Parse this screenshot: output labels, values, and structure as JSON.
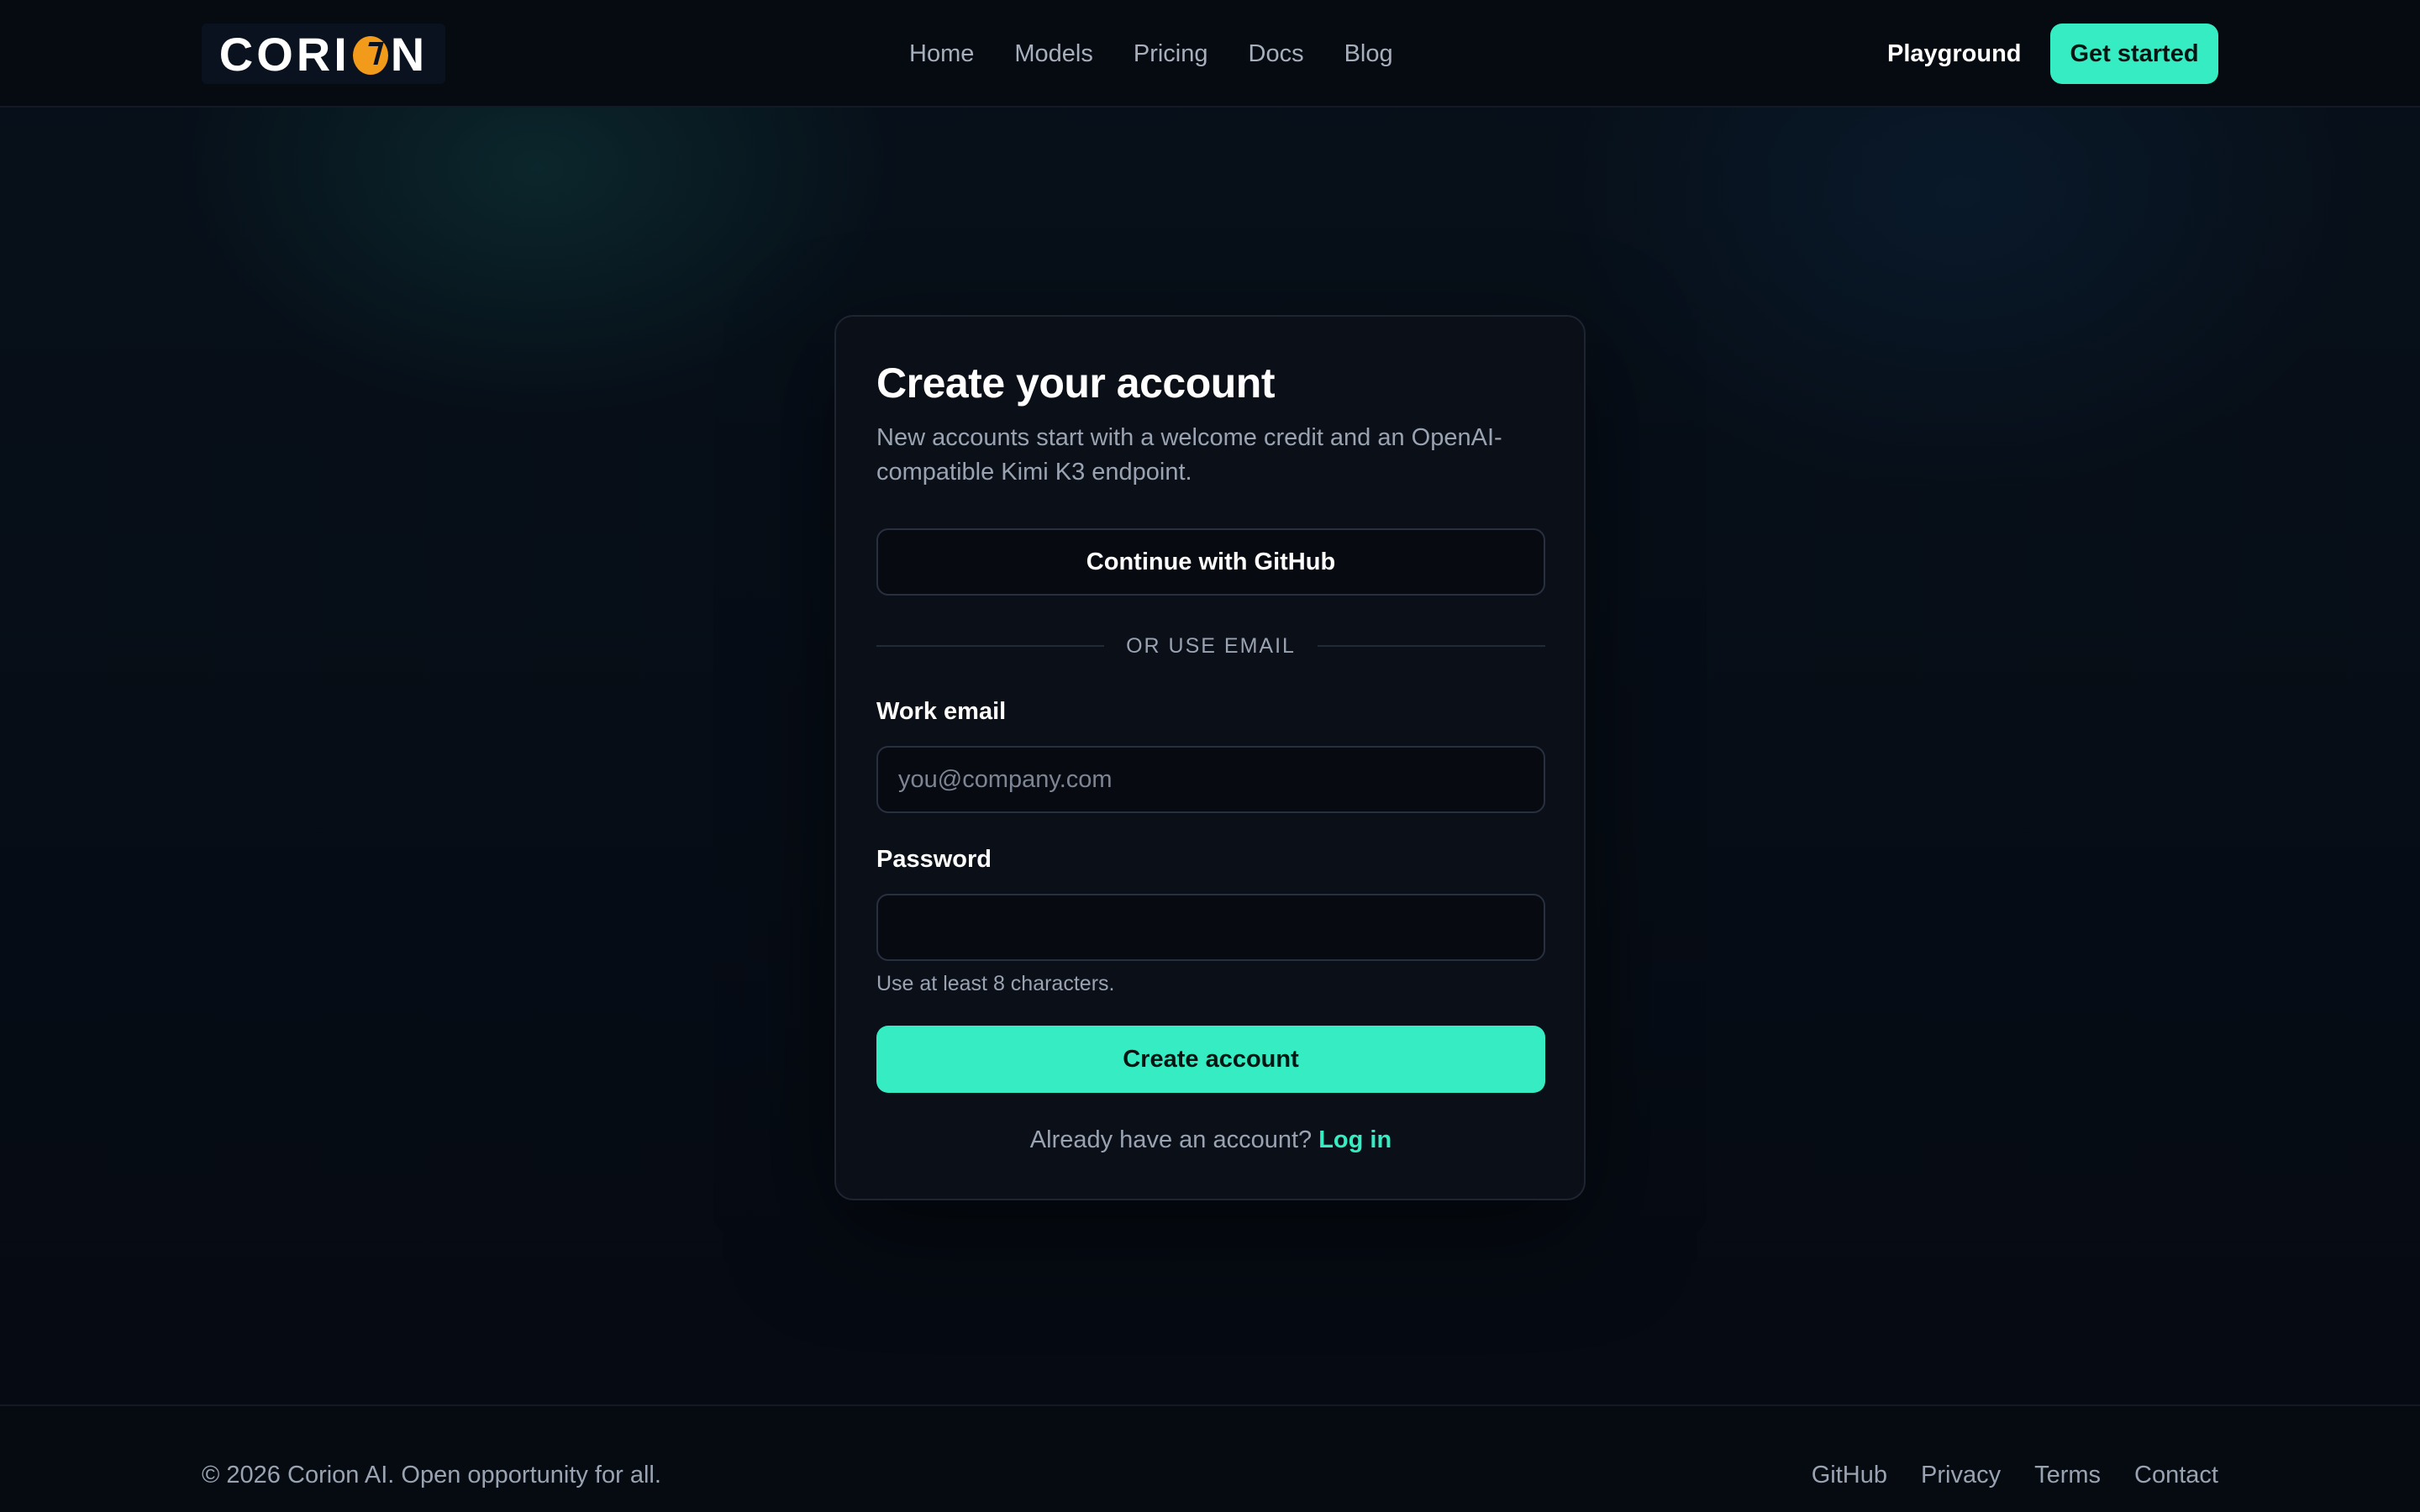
{
  "header": {
    "logo": {
      "prefix": "CORI",
      "suffix": "N",
      "accent_color": "#f29a1a"
    },
    "nav": [
      {
        "label": "Home"
      },
      {
        "label": "Models"
      },
      {
        "label": "Pricing"
      },
      {
        "label": "Docs"
      },
      {
        "label": "Blog"
      }
    ],
    "playground_label": "Playground",
    "get_started_label": "Get started"
  },
  "signup": {
    "title": "Create your account",
    "subtitle": "New accounts start with a welcome credit and an OpenAI-compatible Kimi K3 endpoint.",
    "github_label": "Continue with GitHub",
    "divider_label": "OR USE EMAIL",
    "email": {
      "label": "Work email",
      "placeholder": "you@company.com",
      "value": ""
    },
    "password": {
      "label": "Password",
      "value": "",
      "hint": "Use at least 8 characters."
    },
    "submit_label": "Create account",
    "login_prompt": "Already have an account?",
    "login_link": "Log in"
  },
  "footer": {
    "copyright": "© 2026 Corion AI. Open opportunity for all.",
    "links": [
      {
        "label": "GitHub"
      },
      {
        "label": "Privacy"
      },
      {
        "label": "Terms"
      },
      {
        "label": "Contact"
      }
    ]
  },
  "colors": {
    "accent": "#35ecc3",
    "background": "#070b13",
    "card": "#0b0f18",
    "logo_accent": "#f29a1a"
  }
}
